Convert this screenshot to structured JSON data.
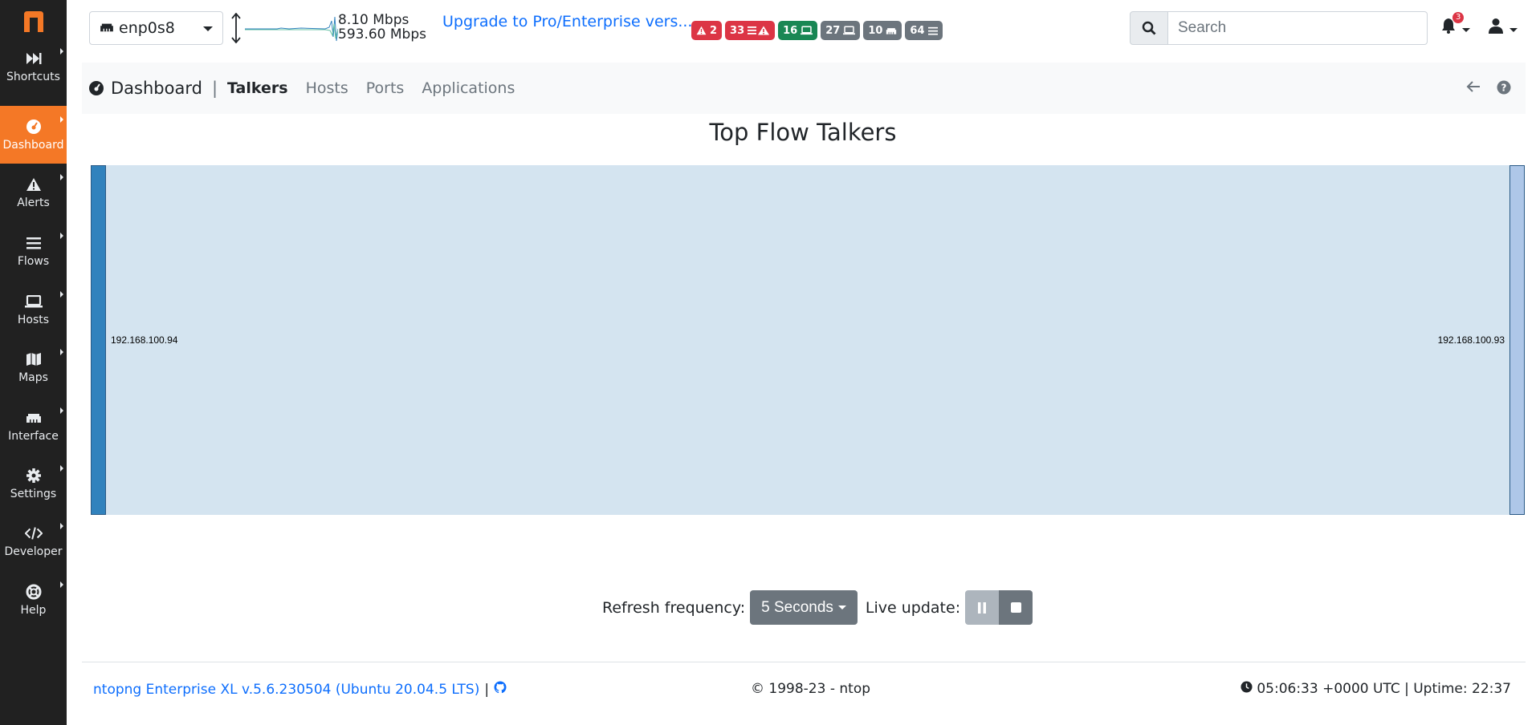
{
  "sidebar": {
    "items": [
      {
        "label": "Shortcuts",
        "icon": "fast-forward-icon"
      },
      {
        "label": "Dashboard",
        "icon": "tachometer-icon",
        "active": true
      },
      {
        "label": "Alerts",
        "icon": "warning-icon"
      },
      {
        "label": "Flows",
        "icon": "bars-icon"
      },
      {
        "label": "Hosts",
        "icon": "laptop-icon"
      },
      {
        "label": "Maps",
        "icon": "map-icon"
      },
      {
        "label": "Interface",
        "icon": "ethernet-icon"
      },
      {
        "label": "Settings",
        "icon": "gear-icon"
      },
      {
        "label": "Developer",
        "icon": "code-icon"
      },
      {
        "label": "Help",
        "icon": "life-ring-icon"
      }
    ]
  },
  "topbar": {
    "interface": "enp0s8",
    "upload_speed": "8.10 Mbps",
    "download_speed": "593.60 Mbps",
    "upgrade_text": "Upgrade to Pro/Enterprise vers...",
    "badges": [
      {
        "value": "2",
        "color": "#dc3545",
        "icon": "warning-icon"
      },
      {
        "value": "33",
        "color": "#dc3545",
        "icon": "flow-alert-icon"
      },
      {
        "value": "16",
        "color": "#198754",
        "icon": "laptop-icon"
      },
      {
        "value": "27",
        "color": "#6c757d",
        "icon": "laptop-icon"
      },
      {
        "value": "10",
        "color": "#6c757d",
        "icon": "ethernet-icon"
      },
      {
        "value": "64",
        "color": "#6c757d",
        "icon": "bars-icon"
      }
    ],
    "search_placeholder": "Search",
    "notification_count": "3"
  },
  "subnav": {
    "title": "Dashboard",
    "tabs": [
      {
        "label": "Talkers",
        "active": true
      },
      {
        "label": "Hosts"
      },
      {
        "label": "Ports"
      },
      {
        "label": "Applications"
      }
    ]
  },
  "main": {
    "title": "Top Flow Talkers"
  },
  "chart_data": {
    "type": "sankey",
    "nodes": [
      {
        "name": "192.168.100.94",
        "side": "left",
        "color": "#3182bd"
      },
      {
        "name": "192.168.100.93",
        "side": "right",
        "color": "#aec7e8"
      }
    ],
    "links": [
      {
        "source": "192.168.100.94",
        "target": "192.168.100.93",
        "value": 1
      }
    ],
    "link_color": "#d4e4f0"
  },
  "controls": {
    "refresh_label": "Refresh frequency:",
    "refresh_value": "5 Seconds",
    "live_label": "Live update:"
  },
  "footer": {
    "version": "ntopng Enterprise XL v.5.6.230504 (Ubuntu 20.04.5 LTS)",
    "copyright": "© 1998-23 - ntop",
    "time": "05:06:33 +0000 UTC | Uptime: 22:37"
  }
}
